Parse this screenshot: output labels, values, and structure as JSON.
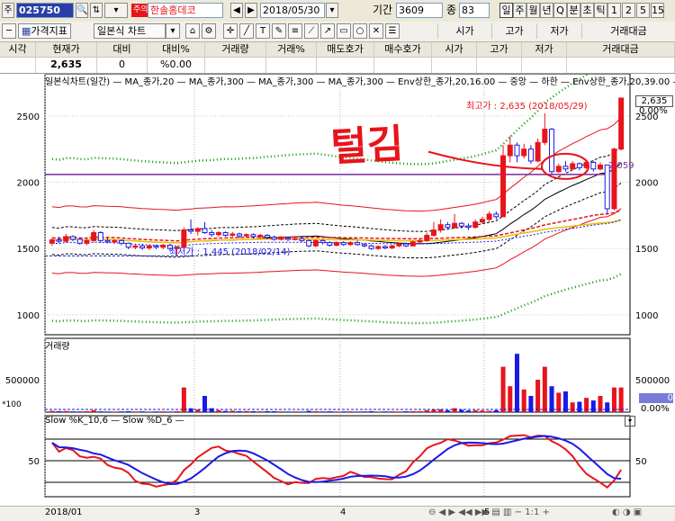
{
  "toolbar": {
    "market_label": "주",
    "code": "025750",
    "flag_label": "주의",
    "stock_name": "한솔홈데코",
    "date": "2018/05/30",
    "period_label": "기간",
    "period_value": "3609",
    "count_label": "종",
    "count_value": "83",
    "period_buttons": [
      "일",
      "주",
      "월",
      "년",
      "Q",
      "분",
      "초",
      "틱",
      "1",
      "2",
      "5",
      "15"
    ]
  },
  "toolbar2": {
    "indicator_button": "가격지표",
    "chart_type": "일본식 차트",
    "columns": [
      "시가",
      "고가",
      "저가",
      "거래대금"
    ]
  },
  "quote_header": {
    "labels": [
      "시각",
      "현재가",
      "대비",
      "대비%",
      "거래량",
      "거래%",
      "매도호가",
      "매수호가",
      "시가",
      "고가",
      "저가",
      "거래대금"
    ],
    "values": [
      "",
      "2,635",
      "0",
      "%0.00",
      "",
      "",
      "",
      "",
      "",
      "",
      "",
      ""
    ]
  },
  "price_pane": {
    "legend": "일본식차트(일간) — MA_종가,20 — MA_종가,300 — MA_종가,300 — MA_종가,300 — Env상한_종가,20,16.00 — 중앙 — 하한 — Env상한_종가,20,39.00 —",
    "high_annotation": "최고가 : 2,635 (2018/05/29)",
    "low_annotation": "최저가 : 1,445 (2018/02/14)",
    "level_label": "2,059",
    "current_price_box": "2,635",
    "current_pct": "0.00%",
    "y_ticks": [
      "2500",
      "2000",
      "1500",
      "1000"
    ],
    "handwriting": "털김"
  },
  "volume_pane": {
    "legend": "거래량",
    "y_ticks": [
      "500000"
    ],
    "unit_label": "*100",
    "right_box": "0",
    "right_pct": "0.00%"
  },
  "stoch_pane": {
    "legend": "Slow %K_10,6 — Slow %D_6 —",
    "y_ticks": [
      "50"
    ]
  },
  "x_axis": {
    "labels": [
      "2018/01",
      "3",
      "4",
      "5"
    ]
  },
  "colors": {
    "up": "#e8141c",
    "down": "#1a1ae6",
    "env_outer": "#0a9a0a",
    "accent": "#7a2a9a",
    "panel_bg": "#ece9d8"
  },
  "chart_data": {
    "type": "candlestick",
    "period": "daily",
    "x_range": [
      "2018/01",
      "2018/05/30"
    ],
    "y_range": [
      850,
      2750
    ],
    "series": [
      {
        "name": "MA_종가,20",
        "color": "#e8141c"
      },
      {
        "name": "MA_종가,300",
        "color": "#e8141c"
      },
      {
        "name": "MA_종가,300",
        "color": "#e8141c"
      },
      {
        "name": "MA_종가,300",
        "color": "#1a1ae6"
      },
      {
        "name": "Env상한_종가,20,16.00",
        "color": "#1a1ae6"
      },
      {
        "name": "중앙",
        "color": "#000000"
      },
      {
        "name": "하한",
        "color": "#000000"
      },
      {
        "name": "Env상한_종가,20,39.00",
        "color": "#0a9a0a"
      }
    ],
    "candles": [
      {
        "o": 1540,
        "c": 1565,
        "h": 1580,
        "l": 1520
      },
      {
        "o": 1565,
        "c": 1555,
        "h": 1590,
        "l": 1540
      },
      {
        "o": 1555,
        "c": 1590,
        "h": 1610,
        "l": 1545
      },
      {
        "o": 1590,
        "c": 1570,
        "h": 1600,
        "l": 1555
      },
      {
        "o": 1570,
        "c": 1540,
        "h": 1585,
        "l": 1530
      },
      {
        "o": 1540,
        "c": 1560,
        "h": 1575,
        "l": 1525
      },
      {
        "o": 1560,
        "c": 1620,
        "h": 1640,
        "l": 1550
      },
      {
        "o": 1620,
        "c": 1560,
        "h": 1630,
        "l": 1545
      },
      {
        "o": 1560,
        "c": 1550,
        "h": 1580,
        "l": 1540
      },
      {
        "o": 1550,
        "c": 1560,
        "h": 1570,
        "l": 1535
      },
      {
        "o": 1560,
        "c": 1540,
        "h": 1570,
        "l": 1525
      },
      {
        "o": 1540,
        "c": 1510,
        "h": 1545,
        "l": 1495
      },
      {
        "o": 1510,
        "c": 1520,
        "h": 1530,
        "l": 1495
      },
      {
        "o": 1520,
        "c": 1505,
        "h": 1535,
        "l": 1490
      },
      {
        "o": 1505,
        "c": 1520,
        "h": 1530,
        "l": 1490
      },
      {
        "o": 1520,
        "c": 1510,
        "h": 1530,
        "l": 1495
      },
      {
        "o": 1510,
        "c": 1525,
        "h": 1535,
        "l": 1495
      },
      {
        "o": 1525,
        "c": 1500,
        "h": 1535,
        "l": 1480
      },
      {
        "o": 1500,
        "c": 1510,
        "h": 1520,
        "l": 1445
      },
      {
        "o": 1510,
        "c": 1640,
        "h": 1660,
        "l": 1500
      },
      {
        "o": 1640,
        "c": 1630,
        "h": 1720,
        "l": 1610
      },
      {
        "o": 1630,
        "c": 1650,
        "h": 1660,
        "l": 1600
      },
      {
        "o": 1650,
        "c": 1620,
        "h": 1700,
        "l": 1610
      },
      {
        "o": 1620,
        "c": 1605,
        "h": 1640,
        "l": 1590
      },
      {
        "o": 1605,
        "c": 1620,
        "h": 1630,
        "l": 1590
      },
      {
        "o": 1620,
        "c": 1600,
        "h": 1630,
        "l": 1590
      },
      {
        "o": 1600,
        "c": 1610,
        "h": 1625,
        "l": 1590
      },
      {
        "o": 1610,
        "c": 1595,
        "h": 1620,
        "l": 1580
      },
      {
        "o": 1595,
        "c": 1605,
        "h": 1615,
        "l": 1585
      },
      {
        "o": 1605,
        "c": 1590,
        "h": 1615,
        "l": 1575
      },
      {
        "o": 1590,
        "c": 1600,
        "h": 1610,
        "l": 1575
      },
      {
        "o": 1600,
        "c": 1585,
        "h": 1610,
        "l": 1570
      },
      {
        "o": 1585,
        "c": 1570,
        "h": 1595,
        "l": 1560
      },
      {
        "o": 1570,
        "c": 1580,
        "h": 1590,
        "l": 1560
      },
      {
        "o": 1580,
        "c": 1570,
        "h": 1590,
        "l": 1555
      },
      {
        "o": 1570,
        "c": 1575,
        "h": 1585,
        "l": 1560
      },
      {
        "o": 1575,
        "c": 1560,
        "h": 1585,
        "l": 1550
      },
      {
        "o": 1560,
        "c": 1520,
        "h": 1570,
        "l": 1510
      },
      {
        "o": 1520,
        "c": 1560,
        "h": 1570,
        "l": 1510
      },
      {
        "o": 1560,
        "c": 1545,
        "h": 1570,
        "l": 1530
      },
      {
        "o": 1545,
        "c": 1525,
        "h": 1555,
        "l": 1515
      },
      {
        "o": 1525,
        "c": 1545,
        "h": 1555,
        "l": 1515
      },
      {
        "o": 1545,
        "c": 1530,
        "h": 1555,
        "l": 1520
      },
      {
        "o": 1530,
        "c": 1545,
        "h": 1555,
        "l": 1520
      },
      {
        "o": 1545,
        "c": 1530,
        "h": 1560,
        "l": 1520
      },
      {
        "o": 1530,
        "c": 1520,
        "h": 1540,
        "l": 1510
      },
      {
        "o": 1520,
        "c": 1500,
        "h": 1530,
        "l": 1490
      },
      {
        "o": 1500,
        "c": 1515,
        "h": 1525,
        "l": 1490
      },
      {
        "o": 1515,
        "c": 1505,
        "h": 1525,
        "l": 1495
      },
      {
        "o": 1505,
        "c": 1520,
        "h": 1530,
        "l": 1495
      },
      {
        "o": 1520,
        "c": 1535,
        "h": 1545,
        "l": 1510
      },
      {
        "o": 1535,
        "c": 1520,
        "h": 1545,
        "l": 1510
      },
      {
        "o": 1520,
        "c": 1550,
        "h": 1560,
        "l": 1515
      },
      {
        "o": 1550,
        "c": 1560,
        "h": 1575,
        "l": 1540
      },
      {
        "o": 1560,
        "c": 1600,
        "h": 1620,
        "l": 1550
      },
      {
        "o": 1600,
        "c": 1640,
        "h": 1700,
        "l": 1590
      },
      {
        "o": 1640,
        "c": 1680,
        "h": 1720,
        "l": 1620
      },
      {
        "o": 1680,
        "c": 1660,
        "h": 1700,
        "l": 1640
      },
      {
        "o": 1660,
        "c": 1690,
        "h": 1760,
        "l": 1650
      },
      {
        "o": 1690,
        "c": 1670,
        "h": 1700,
        "l": 1650
      },
      {
        "o": 1670,
        "c": 1660,
        "h": 1690,
        "l": 1640
      },
      {
        "o": 1660,
        "c": 1700,
        "h": 1720,
        "l": 1650
      },
      {
        "o": 1700,
        "c": 1720,
        "h": 1740,
        "l": 1690
      },
      {
        "o": 1720,
        "c": 1760,
        "h": 1780,
        "l": 1700
      },
      {
        "o": 1760,
        "c": 1740,
        "h": 1780,
        "l": 1720
      },
      {
        "o": 1740,
        "c": 2200,
        "h": 2280,
        "l": 1740
      },
      {
        "o": 2200,
        "c": 2280,
        "h": 2350,
        "l": 2150
      },
      {
        "o": 2280,
        "c": 2200,
        "h": 2300,
        "l": 2150
      },
      {
        "o": 2200,
        "c": 2250,
        "h": 2290,
        "l": 2180
      },
      {
        "o": 2250,
        "c": 2160,
        "h": 2280,
        "l": 2140
      },
      {
        "o": 2160,
        "c": 2300,
        "h": 2330,
        "l": 2150
      },
      {
        "o": 2300,
        "c": 2400,
        "h": 2520,
        "l": 2280
      },
      {
        "o": 2400,
        "c": 2080,
        "h": 2410,
        "l": 2060
      },
      {
        "o": 2080,
        "c": 2120,
        "h": 2140,
        "l": 2070
      },
      {
        "o": 2120,
        "c": 2100,
        "h": 2160,
        "l": 2080
      },
      {
        "o": 2100,
        "c": 2140,
        "h": 2160,
        "l": 2090
      },
      {
        "o": 2140,
        "c": 2110,
        "h": 2150,
        "l": 2090
      },
      {
        "o": 2110,
        "c": 2150,
        "h": 2170,
        "l": 2100
      },
      {
        "o": 2150,
        "c": 2100,
        "h": 2160,
        "l": 2080
      },
      {
        "o": 2100,
        "c": 2130,
        "h": 2150,
        "l": 2090
      },
      {
        "o": 2130,
        "c": 1800,
        "h": 1830,
        "l": 1760
      },
      {
        "o": 1800,
        "c": 2250,
        "h": 2260,
        "l": 1790
      },
      {
        "o": 2250,
        "c": 2635,
        "h": 2635,
        "l": 2240
      }
    ],
    "volume": [
      20,
      15,
      18,
      12,
      10,
      14,
      30,
      12,
      10,
      9,
      11,
      14,
      10,
      12,
      9,
      10,
      12,
      9,
      15,
      380,
      60,
      40,
      250,
      60,
      30,
      20,
      22,
      15,
      18,
      14,
      12,
      16,
      14,
      12,
      10,
      11,
      9,
      20,
      14,
      10,
      12,
      10,
      11,
      12,
      9,
      10,
      14,
      9,
      11,
      12,
      10,
      13,
      15,
      14,
      30,
      40,
      45,
      30,
      60,
      35,
      25,
      30,
      25,
      20,
      30,
      700,
      400,
      900,
      350,
      250,
      500,
      700,
      400,
      300,
      320,
      150,
      160,
      220,
      180,
      250,
      150,
      380,
      380
    ],
    "annotations": [
      "최고가 : 2,635 (2018/05/29)",
      "최저가 : 1,445 (2018/02/14)",
      "2,059"
    ]
  }
}
